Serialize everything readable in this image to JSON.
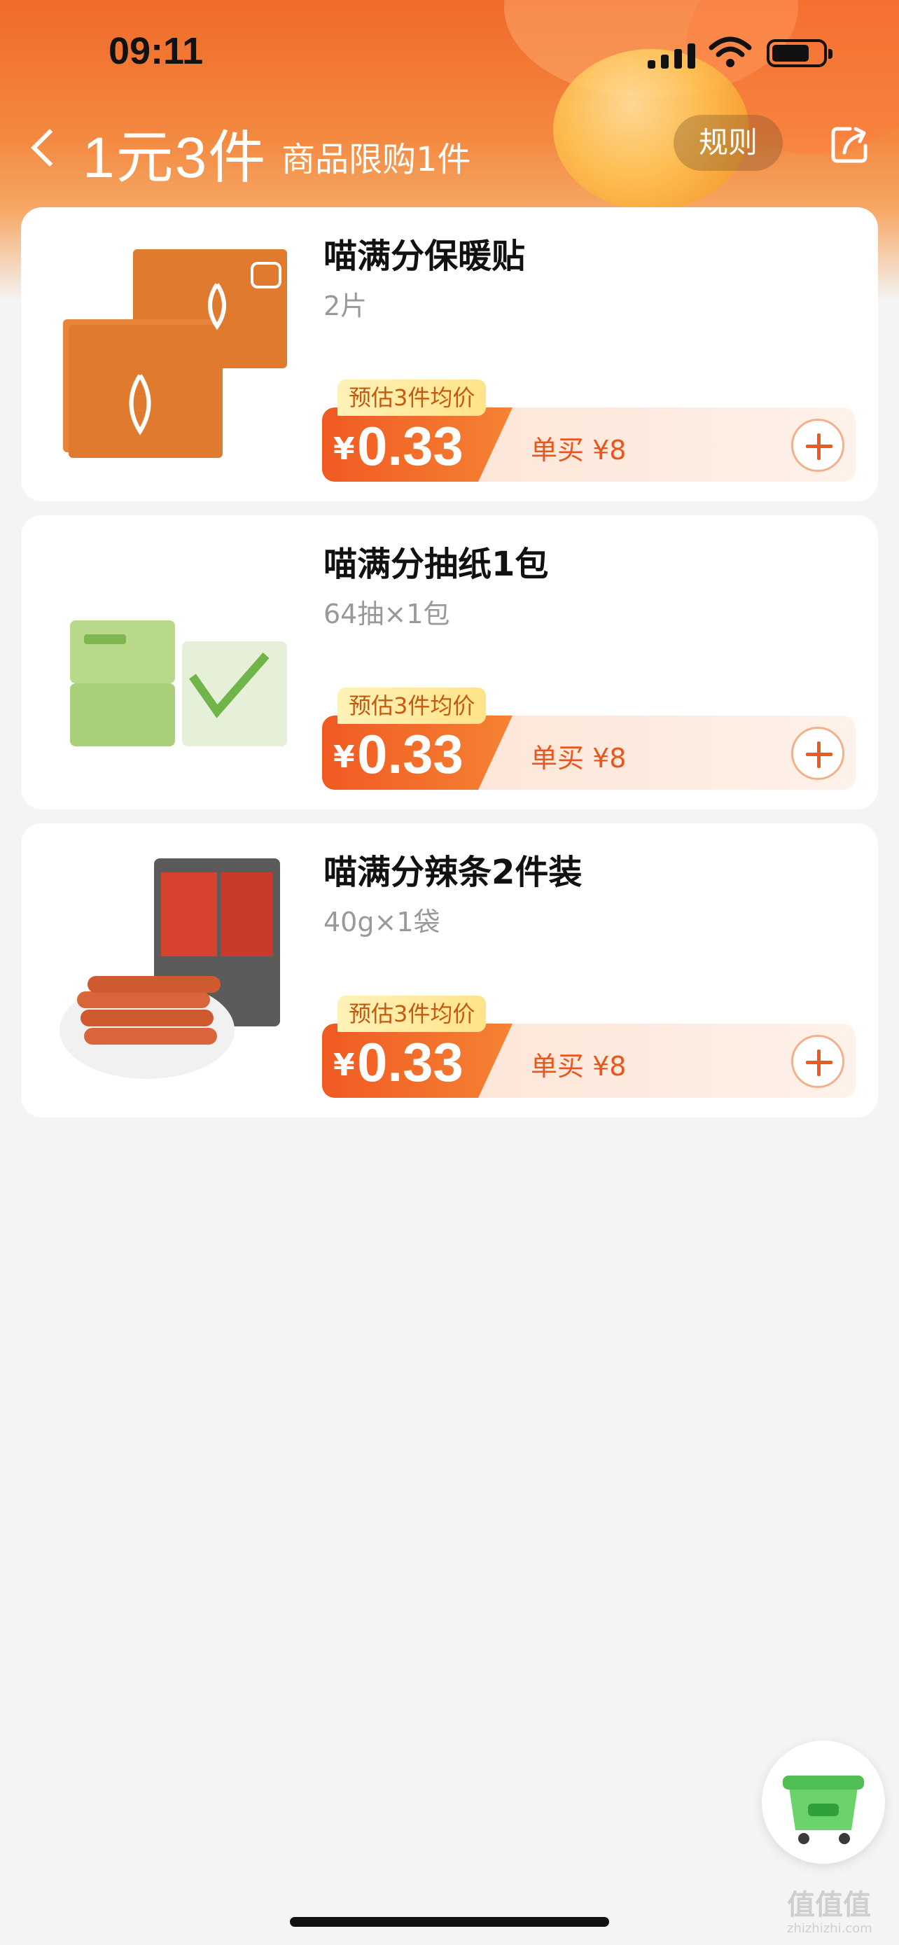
{
  "status_bar": {
    "time": "09:11"
  },
  "nav": {
    "title": "1元3件",
    "subtitle": "商品限购1件",
    "rules_label": "规则"
  },
  "products": [
    {
      "name": "喵满分保暖贴",
      "spec": "2片",
      "tag": "预估3件均价",
      "currency": "¥",
      "price": "0.33",
      "single_price": "单买 ¥8"
    },
    {
      "name": "喵满分抽纸1包",
      "spec": "64抽×1包",
      "tag": "预估3件均价",
      "currency": "¥",
      "price": "0.33",
      "single_price": "单买 ¥8"
    },
    {
      "name": "喵满分辣条2件装",
      "spec": "40g×1袋",
      "tag": "预估3件均价",
      "currency": "¥",
      "price": "0.33",
      "single_price": "单买 ¥8"
    }
  ],
  "watermark": {
    "text": "值值值",
    "sub": "zhizhizhi.com"
  },
  "colors": {
    "accent": "#f05a22",
    "header_top": "#f06a2a",
    "price_text": "#e8571d",
    "tag_bg": "#ffe38a",
    "background": "#f4f4f4"
  },
  "icons": [
    "back-icon",
    "share-icon",
    "plus-icon",
    "shopping-basket-icon",
    "signal-icon",
    "wifi-icon",
    "battery-icon"
  ]
}
